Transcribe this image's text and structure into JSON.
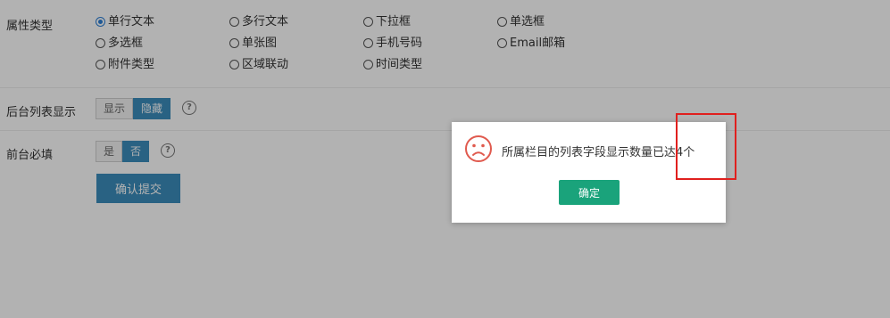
{
  "form": {
    "attr_type_label": "属性类型",
    "options": [
      {
        "label": "单行文本",
        "checked": true
      },
      {
        "label": "多行文本",
        "checked": false
      },
      {
        "label": "下拉框",
        "checked": false
      },
      {
        "label": "单选框",
        "checked": false
      },
      {
        "label": "多选框",
        "checked": false
      },
      {
        "label": "单张图",
        "checked": false
      },
      {
        "label": "手机号码",
        "checked": false
      },
      {
        "label": "Email邮箱",
        "checked": false
      },
      {
        "label": "附件类型",
        "checked": false
      },
      {
        "label": "区域联动",
        "checked": false
      },
      {
        "label": "时间类型",
        "checked": false
      }
    ],
    "list_display": {
      "label": "后台列表显示",
      "show": "显示",
      "hide": "隐藏",
      "selected": "隐藏"
    },
    "required": {
      "label": "前台必填",
      "yes": "是",
      "no": "否",
      "selected": "否"
    },
    "help_glyph": "?",
    "submit_label": "确认提交"
  },
  "dialog": {
    "message": "所属栏目的列表字段显示数量已达4个",
    "ok_label": "确定",
    "icon": "sad-face-icon"
  },
  "colors": {
    "accent": "#3c8dbc",
    "ok_button": "#1aa37b",
    "radio_checked": "#2b7fd6",
    "annotation": "#e0201e",
    "icon": "#e05a4e"
  }
}
